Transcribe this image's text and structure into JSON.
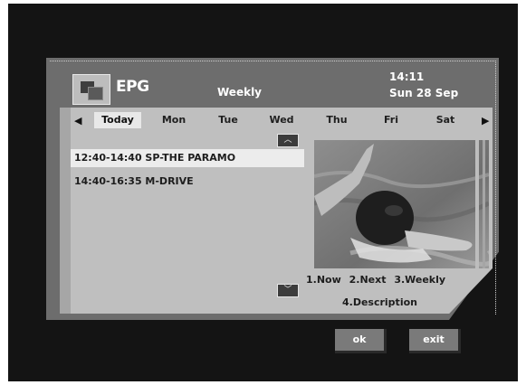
{
  "header": {
    "logo_text": "EPG",
    "mode": "Weekly",
    "time": "14:11",
    "date": "Sun 28 Sep"
  },
  "days": {
    "prev_arrow": "◀",
    "next_arrow": "▶",
    "items": [
      "Today",
      "Mon",
      "Tue",
      "Wed",
      "Thu",
      "Fri",
      "Sat"
    ],
    "selected": "Today"
  },
  "programs": [
    {
      "label": "12:40-14:40 SP-THE PARAMO"
    },
    {
      "label": "14:40-16:35 M-DRIVE"
    }
  ],
  "scroll": {
    "up": "︿",
    "down": "﹀"
  },
  "options": {
    "now": "1.Now",
    "next": "2.Next",
    "weekly": "3.Weekly",
    "description": "4.Description"
  },
  "buttons": {
    "ok": "ok",
    "exit": "exit"
  },
  "colors": {
    "screen": "#141414",
    "frame": "#6d6d6d",
    "panel": "#bfbfbf",
    "highlight": "#ececec"
  }
}
